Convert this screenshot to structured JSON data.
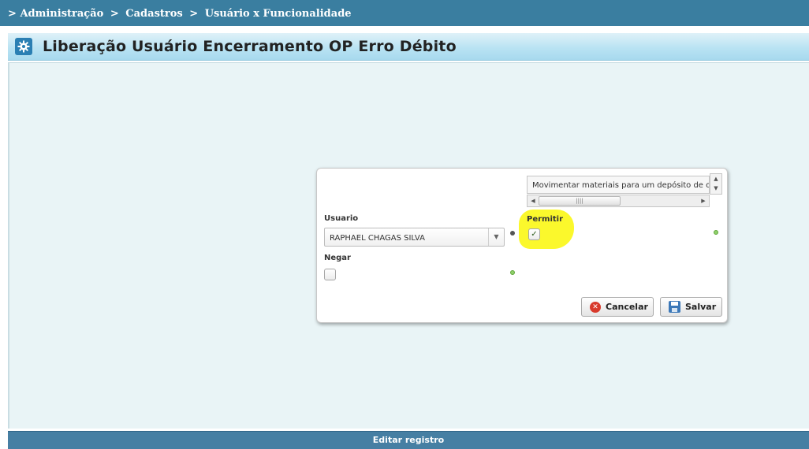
{
  "breadcrumb": {
    "prefix": ">",
    "items": [
      "Administração",
      "Cadastros",
      "Usuário x Funcionalidade"
    ],
    "separator": ">"
  },
  "header": {
    "title": "Liberação Usuário Encerramento OP Erro Débito",
    "icon": "gear-icon"
  },
  "form": {
    "funcionalidade_value": "Movimentar materiais para um depósito de o",
    "usuario_label": "Usuario",
    "usuario_value": "RAPHAEL CHAGAS SILVA",
    "permitir_label": "Permitir",
    "permitir_checked": true,
    "permitir_mark": "✓",
    "negar_label": "Negar",
    "negar_checked": false
  },
  "buttons": {
    "cancel_label": "Cancelar",
    "save_label": "Salvar"
  },
  "footer": {
    "label": "Editar registro"
  },
  "colors": {
    "breadcrumb_bg": "#3a7ea0",
    "content_bg": "#e9f4f6",
    "highlight": "#fbf82c",
    "footer_bg": "#467fa3"
  }
}
